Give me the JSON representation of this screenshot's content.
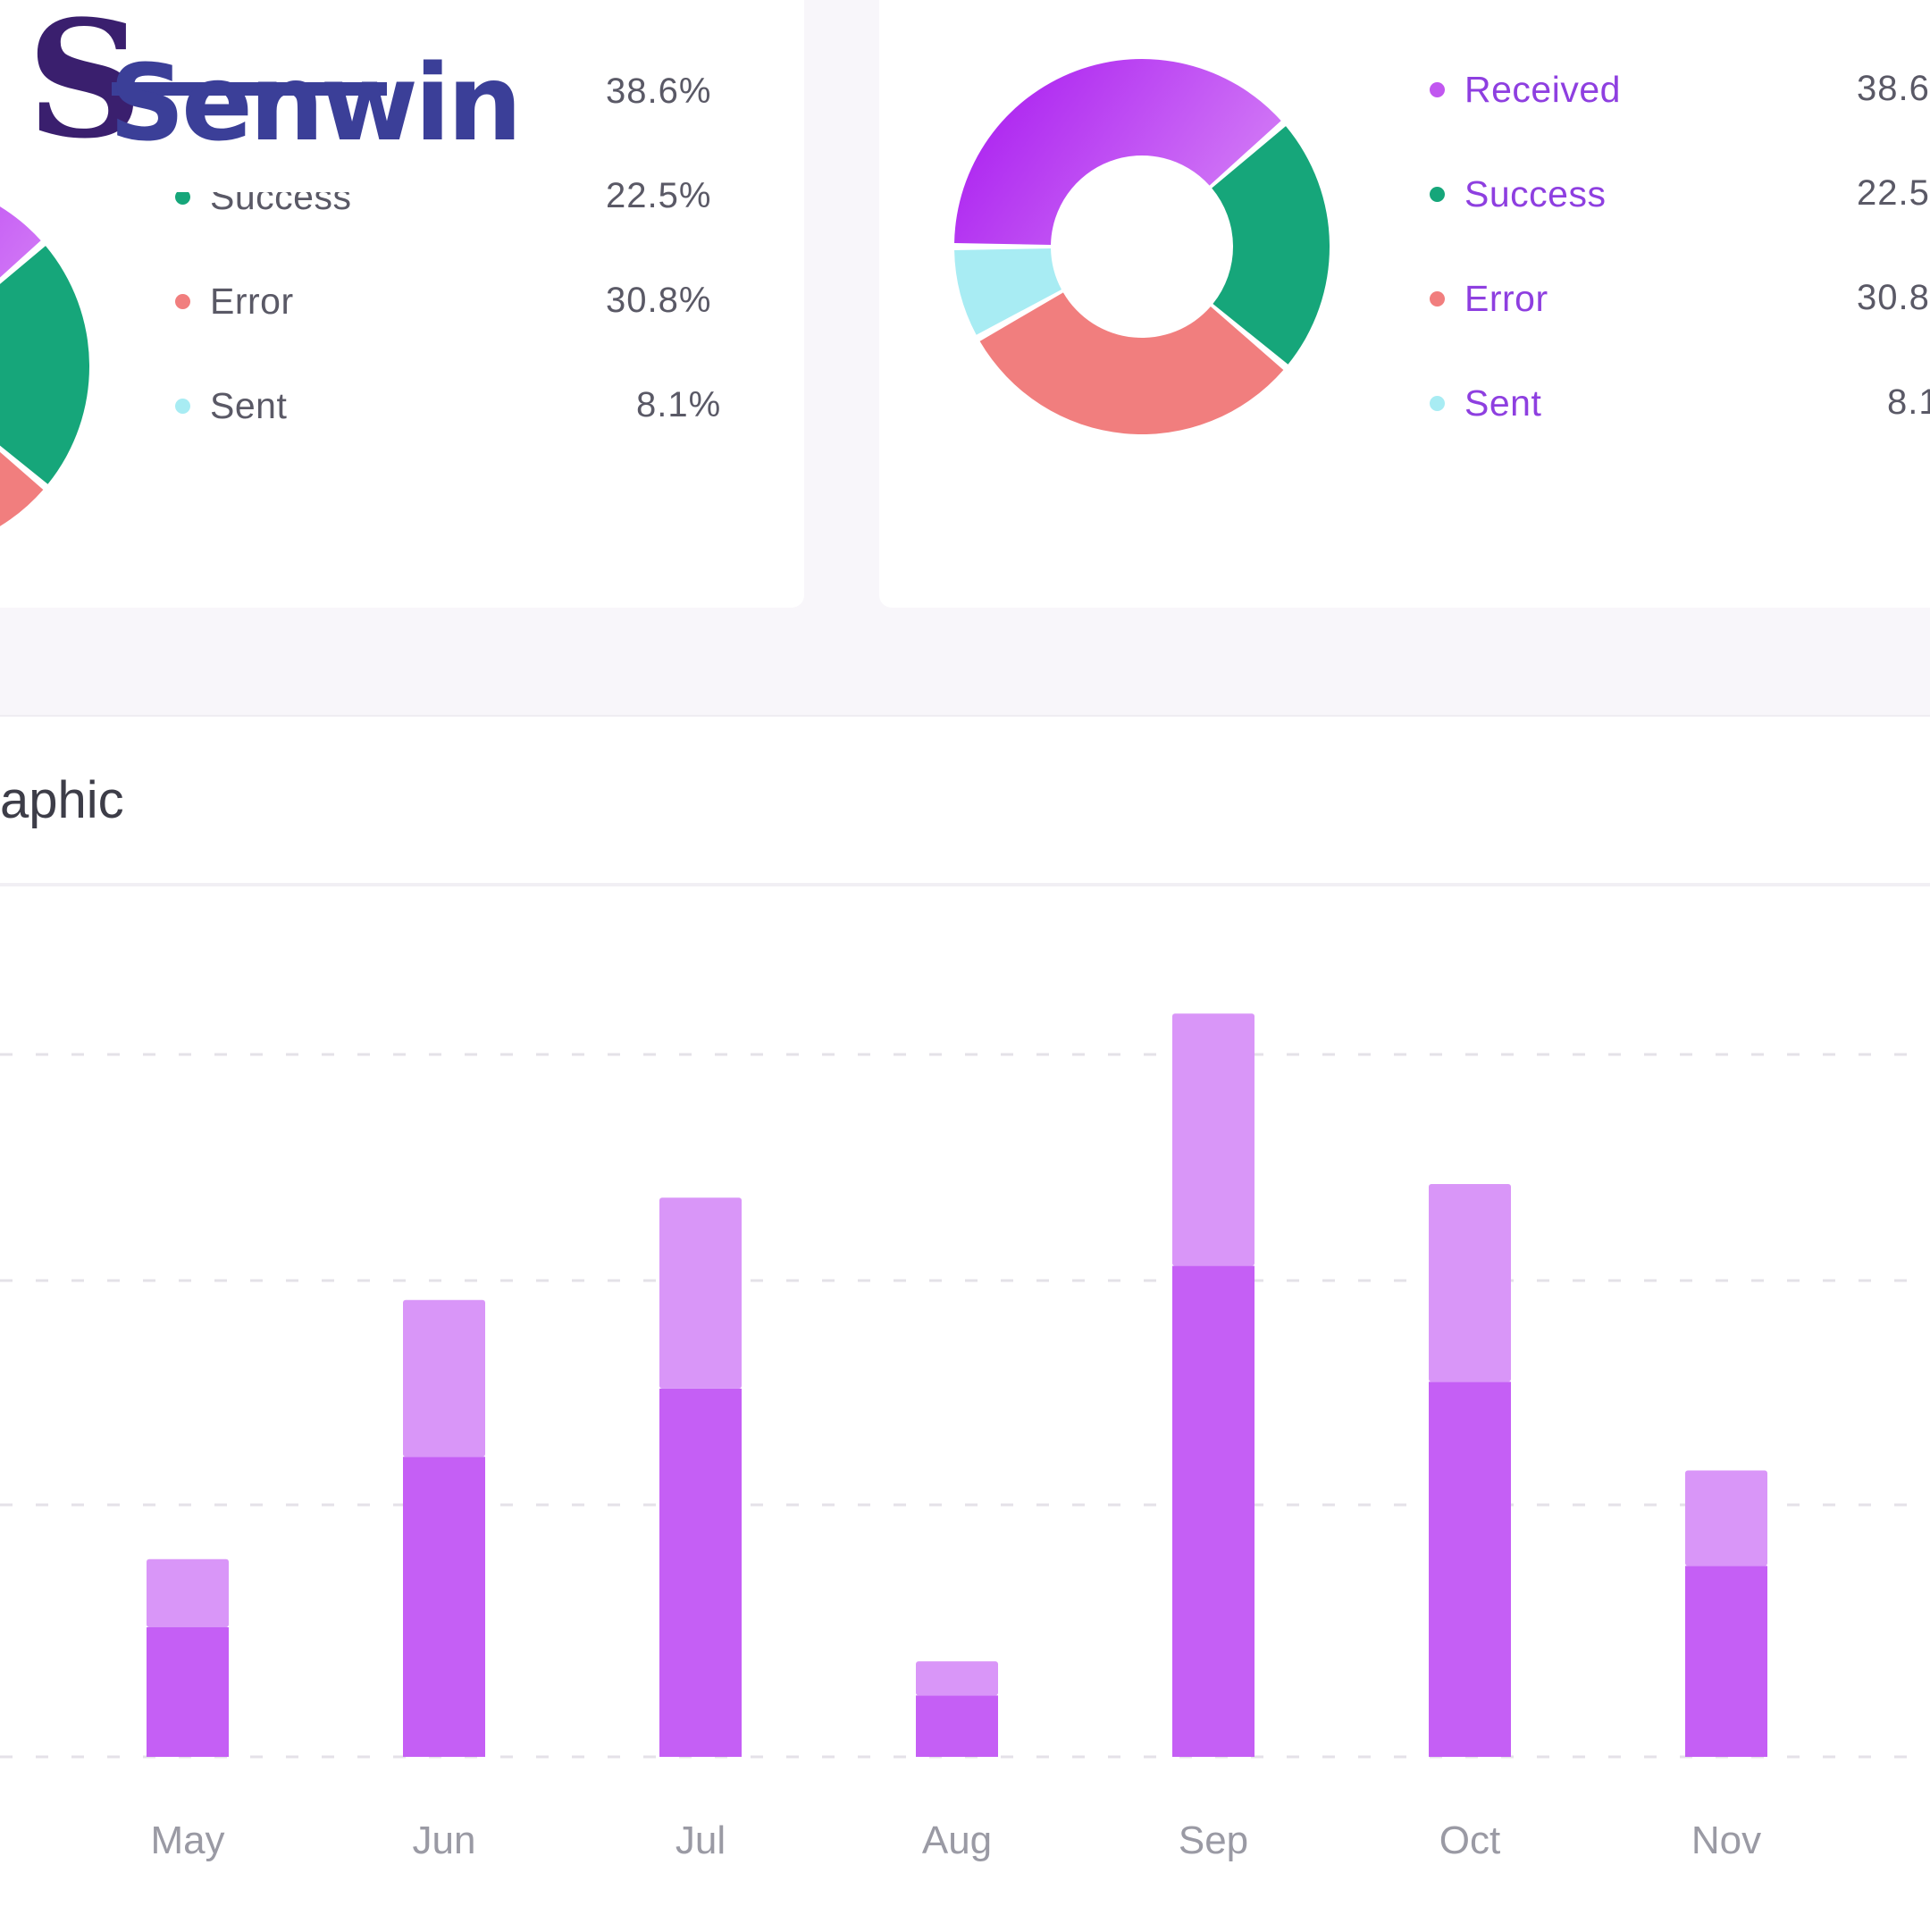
{
  "logo": {
    "text": "Senwin"
  },
  "section": {
    "title": "aphic"
  },
  "legend": [
    {
      "name": "Received",
      "pct": "38.6%",
      "color": "#c157f0"
    },
    {
      "name": "Success",
      "pct": "22.5%",
      "color": "#16a67a"
    },
    {
      "name": "Error",
      "pct": "30.8%",
      "color": "#f17e7e"
    },
    {
      "name": "Sent",
      "pct": "8.1%",
      "color": "#a8ecf3"
    }
  ],
  "legend_right_pct_visible": [
    "38.6",
    "22.5",
    "30.8",
    "8.1"
  ],
  "colors": {
    "received": "#b834f2",
    "received_light": "#d79af8",
    "success": "#16a67a",
    "error": "#f17e7e",
    "sent": "#a8ecf3"
  },
  "chart_data": [
    {
      "type": "pie",
      "variant": "donut",
      "slices": [
        {
          "label": "Received",
          "value": 38.6,
          "color": "#b834f2"
        },
        {
          "label": "Success",
          "value": 22.5,
          "color": "#16a67a"
        },
        {
          "label": "Error",
          "value": 30.8,
          "color": "#f17e7e"
        },
        {
          "label": "Sent",
          "value": 8.1,
          "color": "#a8ecf3"
        }
      ]
    },
    {
      "type": "bar",
      "stacked": true,
      "categories": [
        "May",
        "Jun",
        "Jul",
        "Aug",
        "Sep",
        "Oct",
        "Nov"
      ],
      "series": [
        {
          "values": [
            1.9,
            4.4,
            5.4,
            0.9,
            7.2,
            5.5,
            2.8
          ],
          "color": "#c55ff5"
        },
        {
          "values": [
            1.0,
            2.3,
            2.8,
            0.5,
            3.7,
            2.9,
            1.4
          ],
          "color": "#d996f8"
        }
      ],
      "ylim": [
        0,
        10.7
      ],
      "grid": true,
      "xlabel": "",
      "ylabel": ""
    }
  ]
}
